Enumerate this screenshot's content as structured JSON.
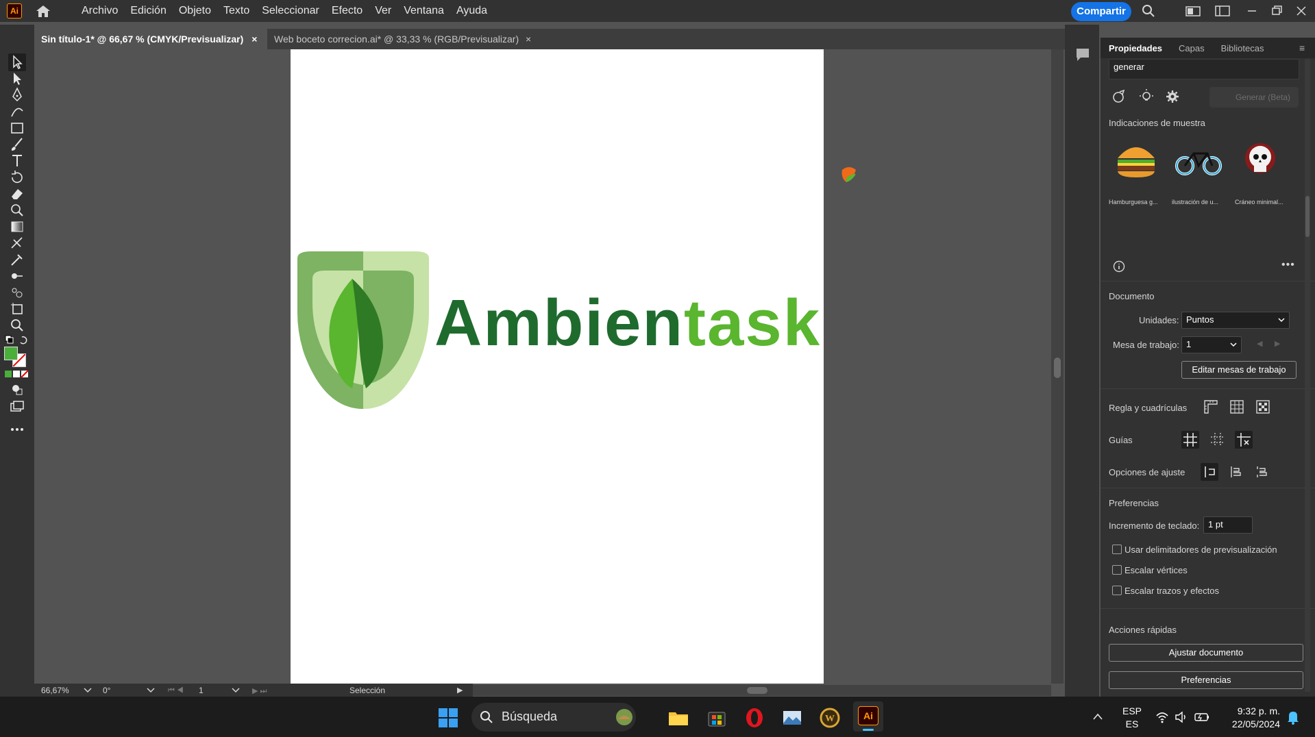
{
  "app": {
    "logo": "Ai",
    "menu": [
      "Archivo",
      "Edición",
      "Objeto",
      "Texto",
      "Seleccionar",
      "Efecto",
      "Ver",
      "Ventana",
      "Ayuda"
    ],
    "share_label": "Compartir",
    "accent": "#1473e6"
  },
  "tabs": [
    {
      "label": "Sin título-1* @ 66,67 % (CMYK/Previsualizar)",
      "close": "×"
    },
    {
      "label": "Web boceto correcion.ai* @ 33,33 % (RGB/Previsualizar)",
      "close": "×"
    }
  ],
  "artwork": {
    "word_dark": "Ambien",
    "word_light": "task",
    "color_dark": "#1f6b2e",
    "color_light": "#5ab52f"
  },
  "status": {
    "zoom": "66,67%",
    "rotation": "0°",
    "artboard": "1",
    "tool": "Selección"
  },
  "panel": {
    "tabs": [
      "Propiedades",
      "Capas",
      "Bibliotecas"
    ],
    "prompt_text": "generar",
    "generate_button": "Generar (Beta)",
    "samples_heading": "Indicaciones de muestra",
    "samples": [
      "Hamburguesa g...",
      "ilustración de u...",
      "Cráneo minimal..."
    ],
    "document_heading": "Documento",
    "units_label": "Unidades:",
    "units_value": "Puntos",
    "artboard_label": "Mesa de trabajo:",
    "artboard_value": "1",
    "edit_artboards": "Editar mesas de trabajo",
    "rulers_label": "Regla y cuadrículas",
    "guides_label": "Guías",
    "snap_label": "Opciones de ajuste",
    "prefs_heading": "Preferencias",
    "keyboard_inc_label": "Incremento de teclado:",
    "keyboard_inc_value": "1 pt",
    "checkboxes": [
      "Usar delimitadores de previsualización",
      "Escalar vértices",
      "Escalar trazos y efectos"
    ],
    "quick_heading": "Acciones rápidas",
    "quick_buttons": [
      "Ajustar documento",
      "Preferencias"
    ]
  },
  "taskbar": {
    "search_placeholder": "Búsqueda",
    "lang_top": "ESP",
    "lang_bottom": "ES",
    "time": "9:32 p. m.",
    "date": "22/05/2024"
  }
}
